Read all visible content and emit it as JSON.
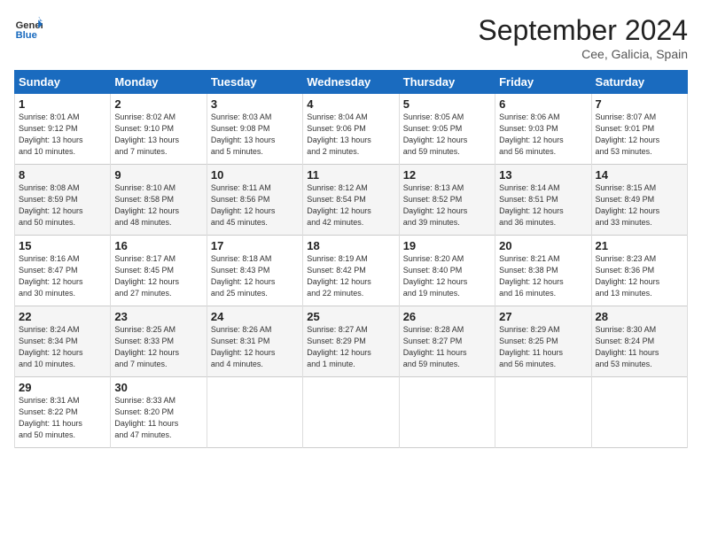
{
  "header": {
    "logo_text_general": "General",
    "logo_text_blue": "Blue",
    "month_title": "September 2024",
    "location": "Cee, Galicia, Spain"
  },
  "days_of_week": [
    "Sunday",
    "Monday",
    "Tuesday",
    "Wednesday",
    "Thursday",
    "Friday",
    "Saturday"
  ],
  "weeks": [
    [
      {
        "day": "1",
        "info": "Sunrise: 8:01 AM\nSunset: 9:12 PM\nDaylight: 13 hours\nand 10 minutes."
      },
      {
        "day": "2",
        "info": "Sunrise: 8:02 AM\nSunset: 9:10 PM\nDaylight: 13 hours\nand 7 minutes."
      },
      {
        "day": "3",
        "info": "Sunrise: 8:03 AM\nSunset: 9:08 PM\nDaylight: 13 hours\nand 5 minutes."
      },
      {
        "day": "4",
        "info": "Sunrise: 8:04 AM\nSunset: 9:06 PM\nDaylight: 13 hours\nand 2 minutes."
      },
      {
        "day": "5",
        "info": "Sunrise: 8:05 AM\nSunset: 9:05 PM\nDaylight: 12 hours\nand 59 minutes."
      },
      {
        "day": "6",
        "info": "Sunrise: 8:06 AM\nSunset: 9:03 PM\nDaylight: 12 hours\nand 56 minutes."
      },
      {
        "day": "7",
        "info": "Sunrise: 8:07 AM\nSunset: 9:01 PM\nDaylight: 12 hours\nand 53 minutes."
      }
    ],
    [
      {
        "day": "8",
        "info": "Sunrise: 8:08 AM\nSunset: 8:59 PM\nDaylight: 12 hours\nand 50 minutes."
      },
      {
        "day": "9",
        "info": "Sunrise: 8:10 AM\nSunset: 8:58 PM\nDaylight: 12 hours\nand 48 minutes."
      },
      {
        "day": "10",
        "info": "Sunrise: 8:11 AM\nSunset: 8:56 PM\nDaylight: 12 hours\nand 45 minutes."
      },
      {
        "day": "11",
        "info": "Sunrise: 8:12 AM\nSunset: 8:54 PM\nDaylight: 12 hours\nand 42 minutes."
      },
      {
        "day": "12",
        "info": "Sunrise: 8:13 AM\nSunset: 8:52 PM\nDaylight: 12 hours\nand 39 minutes."
      },
      {
        "day": "13",
        "info": "Sunrise: 8:14 AM\nSunset: 8:51 PM\nDaylight: 12 hours\nand 36 minutes."
      },
      {
        "day": "14",
        "info": "Sunrise: 8:15 AM\nSunset: 8:49 PM\nDaylight: 12 hours\nand 33 minutes."
      }
    ],
    [
      {
        "day": "15",
        "info": "Sunrise: 8:16 AM\nSunset: 8:47 PM\nDaylight: 12 hours\nand 30 minutes."
      },
      {
        "day": "16",
        "info": "Sunrise: 8:17 AM\nSunset: 8:45 PM\nDaylight: 12 hours\nand 27 minutes."
      },
      {
        "day": "17",
        "info": "Sunrise: 8:18 AM\nSunset: 8:43 PM\nDaylight: 12 hours\nand 25 minutes."
      },
      {
        "day": "18",
        "info": "Sunrise: 8:19 AM\nSunset: 8:42 PM\nDaylight: 12 hours\nand 22 minutes."
      },
      {
        "day": "19",
        "info": "Sunrise: 8:20 AM\nSunset: 8:40 PM\nDaylight: 12 hours\nand 19 minutes."
      },
      {
        "day": "20",
        "info": "Sunrise: 8:21 AM\nSunset: 8:38 PM\nDaylight: 12 hours\nand 16 minutes."
      },
      {
        "day": "21",
        "info": "Sunrise: 8:23 AM\nSunset: 8:36 PM\nDaylight: 12 hours\nand 13 minutes."
      }
    ],
    [
      {
        "day": "22",
        "info": "Sunrise: 8:24 AM\nSunset: 8:34 PM\nDaylight: 12 hours\nand 10 minutes."
      },
      {
        "day": "23",
        "info": "Sunrise: 8:25 AM\nSunset: 8:33 PM\nDaylight: 12 hours\nand 7 minutes."
      },
      {
        "day": "24",
        "info": "Sunrise: 8:26 AM\nSunset: 8:31 PM\nDaylight: 12 hours\nand 4 minutes."
      },
      {
        "day": "25",
        "info": "Sunrise: 8:27 AM\nSunset: 8:29 PM\nDaylight: 12 hours\nand 1 minute."
      },
      {
        "day": "26",
        "info": "Sunrise: 8:28 AM\nSunset: 8:27 PM\nDaylight: 11 hours\nand 59 minutes."
      },
      {
        "day": "27",
        "info": "Sunrise: 8:29 AM\nSunset: 8:25 PM\nDaylight: 11 hours\nand 56 minutes."
      },
      {
        "day": "28",
        "info": "Sunrise: 8:30 AM\nSunset: 8:24 PM\nDaylight: 11 hours\nand 53 minutes."
      }
    ],
    [
      {
        "day": "29",
        "info": "Sunrise: 8:31 AM\nSunset: 8:22 PM\nDaylight: 11 hours\nand 50 minutes."
      },
      {
        "day": "30",
        "info": "Sunrise: 8:33 AM\nSunset: 8:20 PM\nDaylight: 11 hours\nand 47 minutes."
      },
      {
        "day": "",
        "info": ""
      },
      {
        "day": "",
        "info": ""
      },
      {
        "day": "",
        "info": ""
      },
      {
        "day": "",
        "info": ""
      },
      {
        "day": "",
        "info": ""
      }
    ]
  ]
}
